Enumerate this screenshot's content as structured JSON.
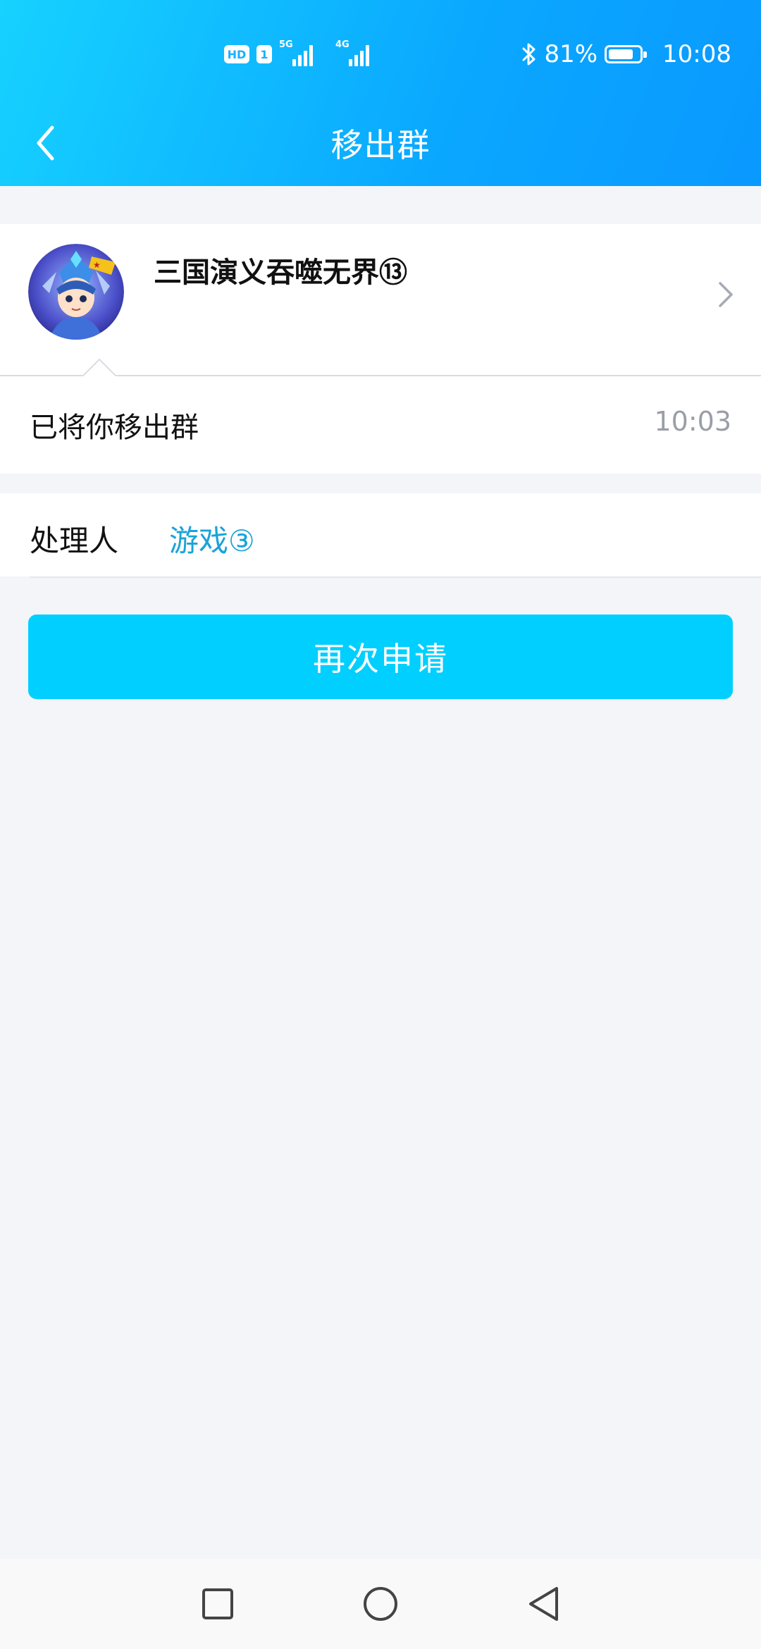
{
  "status_bar": {
    "hd_label": "HD",
    "sim_label": "1",
    "network_1": "5G",
    "network_2": "4G",
    "battery_percent": "81%",
    "battery_level": 0.81,
    "time": "10:08",
    "bluetooth_icon": "bluetooth-icon"
  },
  "nav": {
    "title": "移出群",
    "back_icon": "chevron-left-icon"
  },
  "group": {
    "name": "三国演义吞噬无界⑬",
    "avatar_icon": "group-avatar",
    "chevron_icon": "chevron-right-icon"
  },
  "message": {
    "text": "已将你移出群",
    "time": "10:03"
  },
  "handler": {
    "label": "处理人",
    "name": "游戏③"
  },
  "actions": {
    "reapply_label": "再次申请"
  },
  "system_nav": {
    "recents_icon": "square-icon",
    "home_icon": "circle-icon",
    "back_icon": "triangle-back-icon"
  },
  "colors": {
    "header_start": "#16d2ff",
    "header_end": "#0a99ff",
    "button": "#00cfff",
    "handler_link": "#1aa3d9",
    "background": "#f3f5f9"
  }
}
